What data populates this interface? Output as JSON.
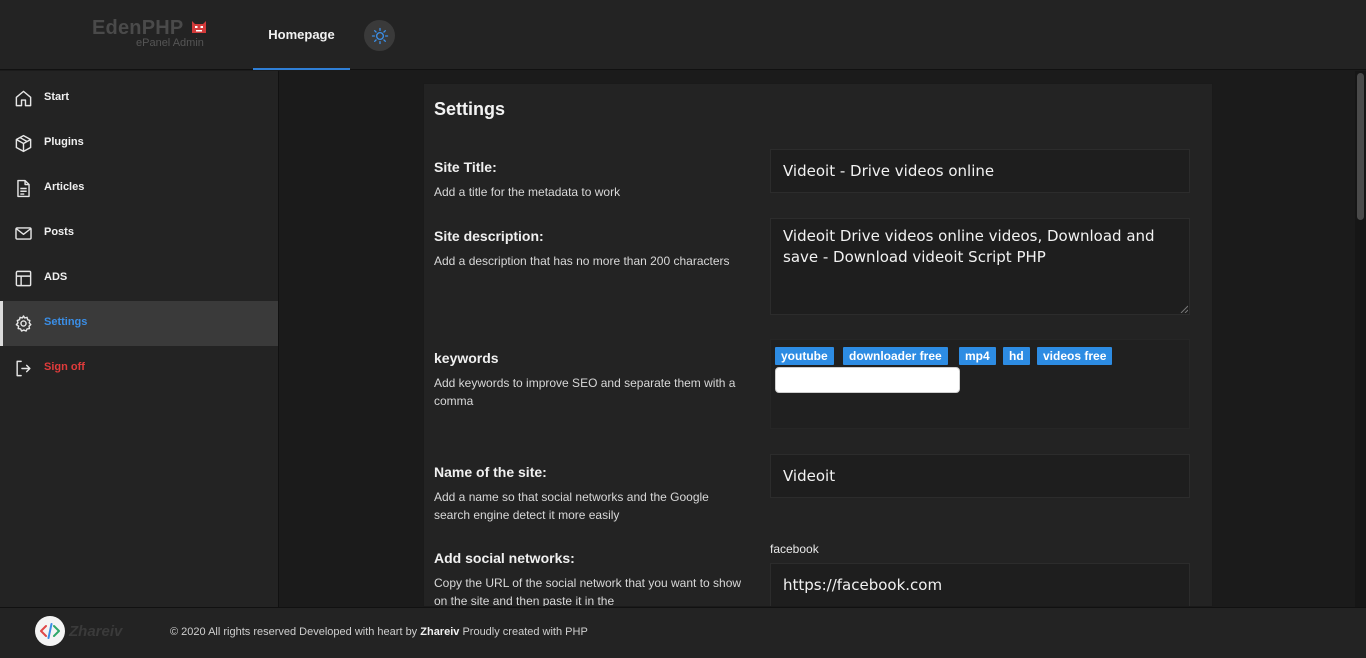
{
  "header": {
    "logo_name": "EdenPHP",
    "logo_subtitle": "ePanel Admin",
    "nav_home": "Homepage",
    "theme_icon": "sun-icon"
  },
  "sidebar": {
    "items": [
      {
        "label": "Start",
        "icon": "home-icon"
      },
      {
        "label": "Plugins",
        "icon": "package-icon"
      },
      {
        "label": "Articles",
        "icon": "document-icon"
      },
      {
        "label": "Posts",
        "icon": "mail-icon"
      },
      {
        "label": "ADS",
        "icon": "layout-icon"
      },
      {
        "label": "Settings",
        "icon": "gear-icon",
        "active": true
      },
      {
        "label": "Sign off",
        "icon": "logout-icon"
      }
    ],
    "active_color": "#3a8ee6",
    "signoff_color": "#e03b3b"
  },
  "settings": {
    "title": "Settings",
    "site_title": {
      "label": "Site Title:",
      "help": "Add a title for the metadata to work",
      "value": "Videoit - Drive videos online"
    },
    "site_description": {
      "label": "Site description:",
      "help": "Add a description that has no more than 200 characters",
      "value": "Videoit Drive videos online  videos, Download  and save - Download videoit Script PHP"
    },
    "keywords": {
      "label": "keywords",
      "help": "Add keywords to improve SEO and separate them with a comma",
      "tags": [
        "youtube",
        "downloader free",
        "mp4",
        "hd",
        "videos free"
      ],
      "tag_color": "#2d8ce3",
      "input_value": ""
    },
    "site_name": {
      "label": "Name of the site:",
      "help": "Add a name so that social networks and the Google search engine detect it more easily",
      "value": "Videoit"
    },
    "social": {
      "label": "Add social networks:",
      "help": "Copy the URL of the social network that you want to show on the site and then paste it in the",
      "facebook_label": "facebook",
      "facebook_value": "https://facebook.com"
    }
  },
  "footer": {
    "logo_text": "Zhareiv",
    "text_before": "© 2020 All rights reserved Developed with heart by ",
    "author": "Zhareiv",
    "text_after": " Proudly created with PHP"
  }
}
